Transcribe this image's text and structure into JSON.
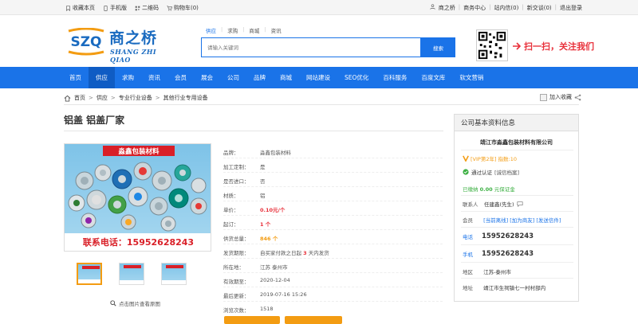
{
  "topbar": {
    "left": [
      "收藏本页",
      "手机版",
      "二维码",
      "购物车(0)"
    ],
    "right": [
      "商之桥",
      "商务中心",
      "站内信(0)",
      "新交谈(0)",
      "退出登录"
    ]
  },
  "logo": {
    "cn": "商之桥",
    "pinyin": "SHANG ZHI QIAO",
    "mark": "SZQ"
  },
  "search": {
    "tabs": [
      "供应",
      "求购",
      "商城",
      "资讯"
    ],
    "active_tab": "供应",
    "placeholder": "请输入关键词",
    "button": "搜索"
  },
  "slogan": "扫一扫，关注我们",
  "nav": [
    "首页",
    "供应",
    "求购",
    "资讯",
    "会员",
    "展会",
    "公司",
    "品牌",
    "商城",
    "网站建设",
    "SEO优化",
    "百科服务",
    "百度文库",
    "软文营销"
  ],
  "nav_active": "供应",
  "breadcrumb": [
    "首页",
    "供应",
    "专业行业设备",
    "其他行业专用设备"
  ],
  "favorite": "加入收藏",
  "product": {
    "title": "铝盖 铝盖厂家",
    "image_brand": "淼鑫包装材料",
    "image_phone": "联系电话：15952628243",
    "zoom_tip": "点击图片查看原图"
  },
  "attrs": {
    "brand": {
      "k": "品牌：",
      "v": "淼鑫包装材料"
    },
    "custom": {
      "k": "加工定制：",
      "v": "是"
    },
    "import": {
      "k": "是否进口：",
      "v": "否"
    },
    "material": {
      "k": "材质：",
      "v": "铝"
    },
    "price": {
      "k": "单价：",
      "v": "0.10元/个"
    },
    "min": {
      "k": "起订：",
      "v": "1 个"
    },
    "total": {
      "k": "供货总量：",
      "v": "846 个"
    },
    "ship": {
      "k": "发货期限：",
      "v1": "自买家付款之日起",
      "days": "3",
      "v2": "天内发货"
    },
    "location": {
      "k": "所在地：",
      "v": "江苏 泰州市"
    },
    "expire": {
      "k": "有效期至：",
      "v": "2020-12-04"
    },
    "updated": {
      "k": "最后更新：",
      "v": "2019-07-16 15:26"
    },
    "views": {
      "k": "浏览次数：",
      "v": "1518"
    }
  },
  "company": {
    "header": "公司基本资料信息",
    "name": "靖江市淼鑫包装材料有限公司",
    "vip": "[VIP第2年]",
    "index": "指数:10",
    "verified": "通过认证",
    "verified_type": "[诚信档案]",
    "deposit_label": "已缴纳",
    "deposit_amount": "0.00",
    "deposit_unit": "元保证金",
    "contact_label": "联系人",
    "contact_name": "任建鑫(先生)",
    "member_label": "会员",
    "member_links": "[当前离线] [加为商友] [发送信件]",
    "phone_label": "电话",
    "phone": "15952628243",
    "mobile_label": "手机",
    "mobile": "15952628243",
    "region_label": "地区",
    "region": "江苏-泰州市",
    "address_label": "地址",
    "address": "靖江市生祠镇七一村村部内"
  }
}
